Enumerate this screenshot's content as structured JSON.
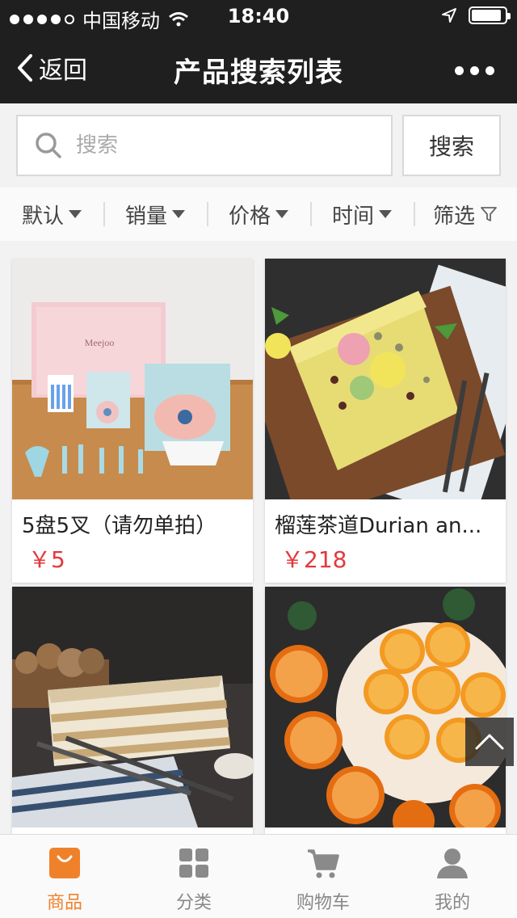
{
  "status": {
    "carrier": "中国移动",
    "time": "18:40"
  },
  "nav": {
    "back_label": "返回",
    "title": "产品搜索列表"
  },
  "search": {
    "placeholder": "搜索",
    "button_label": "搜索"
  },
  "filters": [
    {
      "label": "默认"
    },
    {
      "label": "销量"
    },
    {
      "label": "价格"
    },
    {
      "label": "时间"
    },
    {
      "label": "筛选"
    }
  ],
  "products": [
    {
      "name": "5盘5叉（请勿单拍）",
      "price": "￥5"
    },
    {
      "name": "榴莲茶道Durian an...",
      "price": "￥218"
    },
    {
      "name": "",
      "price": ""
    },
    {
      "name": "",
      "price": ""
    }
  ],
  "tabs": [
    {
      "label": "商品",
      "icon": "shopping-bag-icon",
      "active": true
    },
    {
      "label": "分类",
      "icon": "grid-icon",
      "active": false
    },
    {
      "label": "购物车",
      "icon": "cart-icon",
      "active": false
    },
    {
      "label": "我的",
      "icon": "user-icon",
      "active": false
    }
  ],
  "colors": {
    "accent": "#f0812b",
    "price": "#e4393c",
    "header": "#1f1f1f"
  }
}
